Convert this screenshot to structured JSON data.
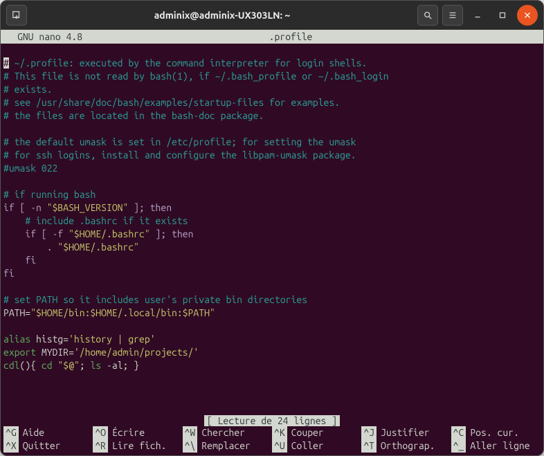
{
  "titlebar": {
    "title": "adminix@adminix-UX303LN: ~"
  },
  "nano": {
    "editor_name": "GNU nano 4.8",
    "file_name": ".profile",
    "status": "[ Lecture de 24 lignes ]"
  },
  "lines": {
    "l1": "# ~/.profile: executed by the command interpreter for login shells.",
    "l1_first": "#",
    "l1_rest": " ~/.profile: executed by the command interpreter for login shells.",
    "l2": "# This file is not read by bash(1), if ~/.bash_profile or ~/.bash_login",
    "l3": "# exists.",
    "l4": "# see /usr/share/doc/bash/examples/startup-files for examples.",
    "l5": "# the files are located in the bash-doc package.",
    "l6": "",
    "l7": "# the default umask is set in /etc/profile; for setting the umask",
    "l8": "# for ssh logins, install and configure the libpam-umask package.",
    "l9": "#umask 022",
    "l10": "",
    "l11": "# if running bash",
    "l12a": "if [ ",
    "l12b": "-n ",
    "l12c": "\"$BASH_VERSION\"",
    "l12d": " ]; ",
    "l12e": "then",
    "l13": "    # include .bashrc if it exists",
    "l14a": "    if [ ",
    "l14b": "-f ",
    "l14c": "\"$HOME/.bashrc\"",
    "l14d": " ]; ",
    "l14e": "then",
    "l15a": "        . ",
    "l15b": "\"$HOME/.bashrc\"",
    "l16": "    fi",
    "l17": "fi",
    "l18": "",
    "l19": "# set PATH so it includes user's private bin directories",
    "l20a": "PATH=",
    "l20b": "\"$HOME/bin:$HOME/.local/bin:$PATH\"",
    "l21": "",
    "l22a": "alias ",
    "l22b": "histg=",
    "l22c": "'history | grep'",
    "l23a": "export ",
    "l23b": "MYDIR=",
    "l23c": "'/home/admin/projects/'",
    "l24a": "cdl",
    "l24b": "(){ ",
    "l24c": "cd ",
    "l24d": "\"$@\"",
    "l24e": "; ",
    "l24f": "ls ",
    "l24g": "-al; }"
  },
  "help": [
    {
      "key": "^G",
      "label": "Aide"
    },
    {
      "key": "^O",
      "label": "Écrire"
    },
    {
      "key": "^W",
      "label": "Chercher"
    },
    {
      "key": "^K",
      "label": "Couper"
    },
    {
      "key": "^J",
      "label": "Justifier"
    },
    {
      "key": "^C",
      "label": "Pos. cur."
    },
    {
      "key": "^X",
      "label": "Quitter"
    },
    {
      "key": "^R",
      "label": "Lire fich."
    },
    {
      "key": "^\\",
      "label": "Remplacer"
    },
    {
      "key": "^U",
      "label": "Coller"
    },
    {
      "key": "^T",
      "label": "Orthograp."
    },
    {
      "key": "^_",
      "label": "Aller ligne"
    }
  ]
}
